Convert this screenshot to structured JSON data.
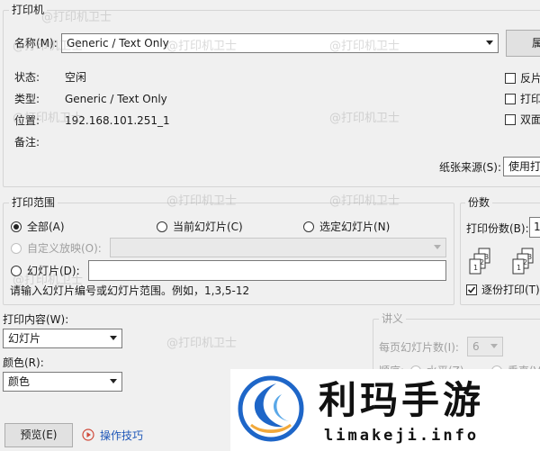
{
  "printer": {
    "group_label": "打印机",
    "name_label": "名称(M):",
    "name_value": "Generic / Text Only",
    "properties_button": "属性",
    "status_label": "状态:",
    "status_value": "空闲",
    "type_label": "类型:",
    "type_value": "Generic / Text Only",
    "location_label": "位置:",
    "location_value": "192.168.101.251_1",
    "comment_label": "备注:",
    "reverse_label": "反片",
    "print_to_file_label": "打印",
    "duplex_label": "双面",
    "paper_source_label": "纸张来源(S):",
    "paper_source_value": "使用打"
  },
  "range": {
    "group_label": "打印范围",
    "all_label": "全部(A)",
    "current_slide_label": "当前幻灯片(C)",
    "selection_label": "选定幻灯片(N)",
    "custom_show_label": "自定义放映(O):",
    "slides_label": "幻灯片(D):",
    "slides_value": "",
    "hint": "请输入幻灯片编号或幻灯片范围。例如，1,3,5-12"
  },
  "copies": {
    "group_label": "份数",
    "count_label": "打印份数(B):",
    "count_value": "1",
    "collate_label": "逐份打印(T)"
  },
  "content": {
    "print_what_label": "打印内容(W):",
    "print_what_value": "幻灯片",
    "color_label": "颜色(R):",
    "color_value": "颜色"
  },
  "handouts": {
    "group_label": "讲义",
    "per_page_label": "每页幻灯片数(I):",
    "per_page_value": "6",
    "order_label": "顺序:",
    "horizontal_label": "水平(Z)",
    "vertical_label": "垂直(V)"
  },
  "footer": {
    "preview_button": "预览(E)",
    "tips_link": "操作技巧"
  },
  "watermarks": {
    "text": "@打印机卫士"
  },
  "brand": {
    "name": "利玛手游",
    "url": "limakeji.info",
    "accent_color": "#1e66c8"
  }
}
